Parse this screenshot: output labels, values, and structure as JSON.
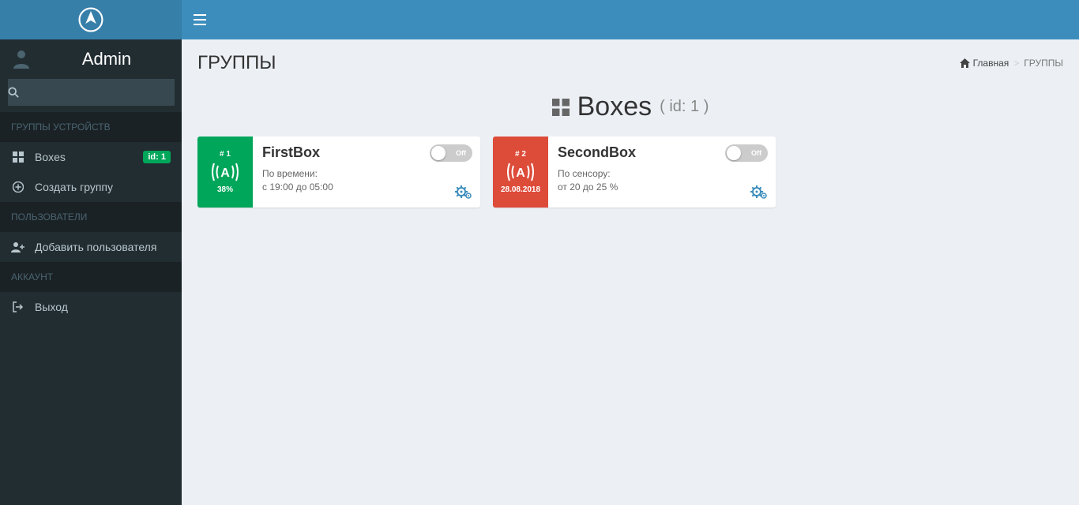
{
  "sidebar": {
    "username": "Admin",
    "search_placeholder": "",
    "sections": {
      "groups_label": "ГРУППЫ УСТРОЙСТВ",
      "users_label": "ПОЛЬЗОВАТЕЛИ",
      "account_label": "АККАУНТ"
    },
    "items": {
      "boxes": {
        "label": "Boxes",
        "badge": "id: 1"
      },
      "create_group": {
        "label": "Создать группу"
      },
      "add_user": {
        "label": "Добавить пользователя"
      },
      "logout": {
        "label": "Выход"
      }
    }
  },
  "page": {
    "title": "ГРУППЫ",
    "breadcrumb_home": "Главная",
    "breadcrumb_current": "ГРУППЫ"
  },
  "group": {
    "name": "Boxes",
    "id_label": "( id: 1 )"
  },
  "boxes": [
    {
      "tag": "# 1",
      "sub": "38%",
      "title": "FirstBox",
      "desc_label": "По времени:",
      "desc_value": "с 19:00 до 05:00",
      "toggle_label": "Off",
      "color": "green"
    },
    {
      "tag": "# 2",
      "sub": "28.08.2018",
      "title": "SecondBox",
      "desc_label": "По сенсору:",
      "desc_value": "от 20 до 25 %",
      "toggle_label": "Off",
      "color": "red"
    }
  ]
}
